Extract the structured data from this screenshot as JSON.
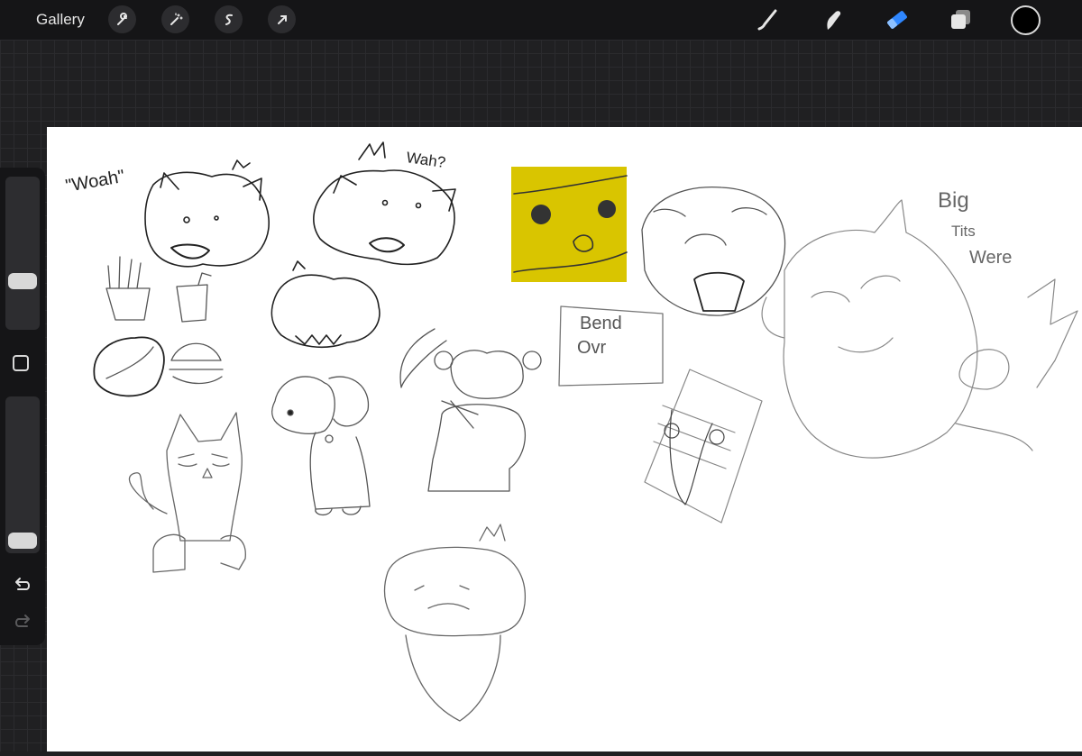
{
  "topbar": {
    "gallery_label": "Gallery",
    "left_tools": [
      "wrench-icon",
      "magic-wand-icon",
      "selection-icon",
      "transform-arrow-icon"
    ],
    "right_tools": [
      "brush-icon",
      "smudge-icon",
      "eraser-icon",
      "layers-icon"
    ],
    "active_tool": "eraser",
    "accent_color": "#2f87ff",
    "current_color": "#000000"
  },
  "sidebar": {
    "brush_size_level": 0.39,
    "opacity_level": 0.03,
    "icons": [
      "modify-square-icon",
      "undo-icon",
      "redo-icon"
    ]
  },
  "canvas": {
    "sketch_texts": {
      "woah": "\"Woah\"",
      "wah": "Wah?",
      "bend1": "Bend",
      "bend2": "Ovr",
      "big": "Big",
      "tits": "Tits",
      "were": "Were"
    },
    "sticky_color": "#d9c500"
  }
}
